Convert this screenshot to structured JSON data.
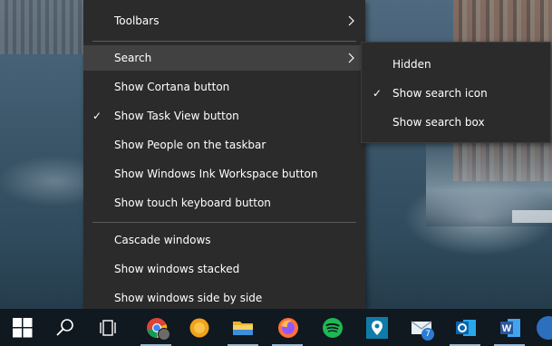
{
  "context_menu": {
    "items": [
      {
        "label": "Toolbars",
        "has_submenu": true,
        "checked": false,
        "highlighted": false
      },
      {
        "label": "Search",
        "has_submenu": true,
        "checked": false,
        "highlighted": true
      },
      {
        "label": "Show Cortana button",
        "has_submenu": false,
        "checked": false,
        "highlighted": false
      },
      {
        "label": "Show Task View button",
        "has_submenu": false,
        "checked": true,
        "highlighted": false
      },
      {
        "label": "Show People on the taskbar",
        "has_submenu": false,
        "checked": false,
        "highlighted": false
      },
      {
        "label": "Show Windows Ink Workspace button",
        "has_submenu": false,
        "checked": false,
        "highlighted": false
      },
      {
        "label": "Show touch keyboard button",
        "has_submenu": false,
        "checked": false,
        "highlighted": false
      },
      {
        "label": "Cascade windows",
        "has_submenu": false,
        "checked": false,
        "highlighted": false
      },
      {
        "label": "Show windows stacked",
        "has_submenu": false,
        "checked": false,
        "highlighted": false
      },
      {
        "label": "Show windows side by side",
        "has_submenu": false,
        "checked": false,
        "highlighted": false
      }
    ],
    "check_glyph": "✓"
  },
  "search_submenu": {
    "items": [
      {
        "label": "Hidden",
        "checked": false
      },
      {
        "label": "Show search icon",
        "checked": true
      },
      {
        "label": "Show search box",
        "checked": false
      }
    ],
    "check_glyph": "✓"
  },
  "taskbar": {
    "mail_badge": "7",
    "word_letter": "W",
    "outlook_letter": "O",
    "colors": {
      "background": "#101820",
      "chrome": "#4285f4",
      "firefox": "#ff7139",
      "spotify": "#1db954",
      "outlook": "#0a64ad",
      "word": "#2b579a",
      "mail_badge": "#2b7cd3"
    },
    "icons": [
      "windows-start-icon",
      "search-icon",
      "task-view-icon",
      "chrome-icon",
      "app-icon-orange",
      "file-explorer-icon",
      "firefox-icon",
      "spotify-icon",
      "maps-icon",
      "mail-icon",
      "outlook-icon",
      "word-icon"
    ]
  }
}
